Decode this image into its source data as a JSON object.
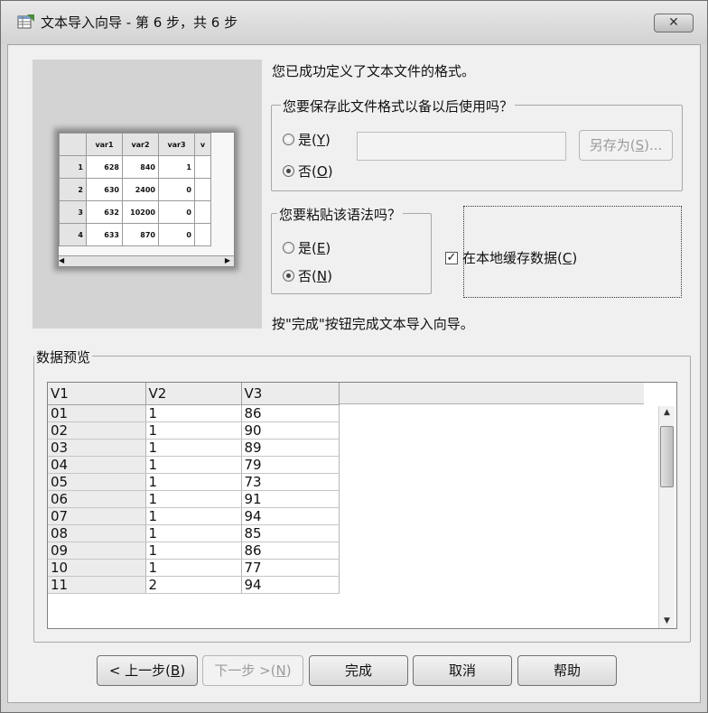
{
  "window": {
    "title": "文本导入向导 - 第 6 步，共 6 步",
    "close_label": "✕"
  },
  "preview_image": {
    "columns": [
      "var1",
      "var2",
      "var3",
      "v"
    ],
    "rows": [
      {
        "n": "1",
        "cells": [
          "628",
          "840",
          "1",
          ""
        ]
      },
      {
        "n": "2",
        "cells": [
          "630",
          "2400",
          "0",
          ""
        ]
      },
      {
        "n": "3",
        "cells": [
          "632",
          "10200",
          "0",
          ""
        ]
      },
      {
        "n": "4",
        "cells": [
          "633",
          "870",
          "0",
          ""
        ]
      }
    ]
  },
  "intro_text": "您已成功定义了文本文件的格式。",
  "save_format": {
    "legend": "您要保存此文件格式以备以后使用吗？",
    "yes_label": "是",
    "yes_key": "Y",
    "no_label": "否",
    "no_key": "O",
    "selected": "no",
    "filename_value": "",
    "save_as_label": "另存为",
    "save_as_key": "S"
  },
  "paste_syntax": {
    "legend": "您要粘贴该语法吗？",
    "yes_label": "是",
    "yes_key": "E",
    "no_label": "否",
    "no_key": "N",
    "selected": "no"
  },
  "cache_data": {
    "label": "在本地缓存数据",
    "key": "C",
    "checked": true
  },
  "finish_hint": "按\"完成\"按钮完成文本导入向导。",
  "data_preview": {
    "legend": "数据预览",
    "headers": [
      "V1",
      "V2",
      "V3"
    ],
    "rows": [
      [
        "01",
        "1",
        "86"
      ],
      [
        "02",
        "1",
        "90"
      ],
      [
        "03",
        "1",
        "89"
      ],
      [
        "04",
        "1",
        "79"
      ],
      [
        "05",
        "1",
        "73"
      ],
      [
        "06",
        "1",
        "91"
      ],
      [
        "07",
        "1",
        "94"
      ],
      [
        "08",
        "1",
        "85"
      ],
      [
        "09",
        "1",
        "86"
      ],
      [
        "10",
        "1",
        "77"
      ],
      [
        "11",
        "2",
        "94"
      ]
    ]
  },
  "buttons": {
    "back_label": "< 上一步(",
    "back_key": "B",
    "next_label": "下一步 >(",
    "next_key": "N",
    "finish": "完成",
    "cancel": "取消",
    "help": "帮助"
  },
  "colors": {
    "window_bg": "#f0f0f0",
    "titlebar": "#d6d6d6",
    "selected_radio": "#444444"
  }
}
